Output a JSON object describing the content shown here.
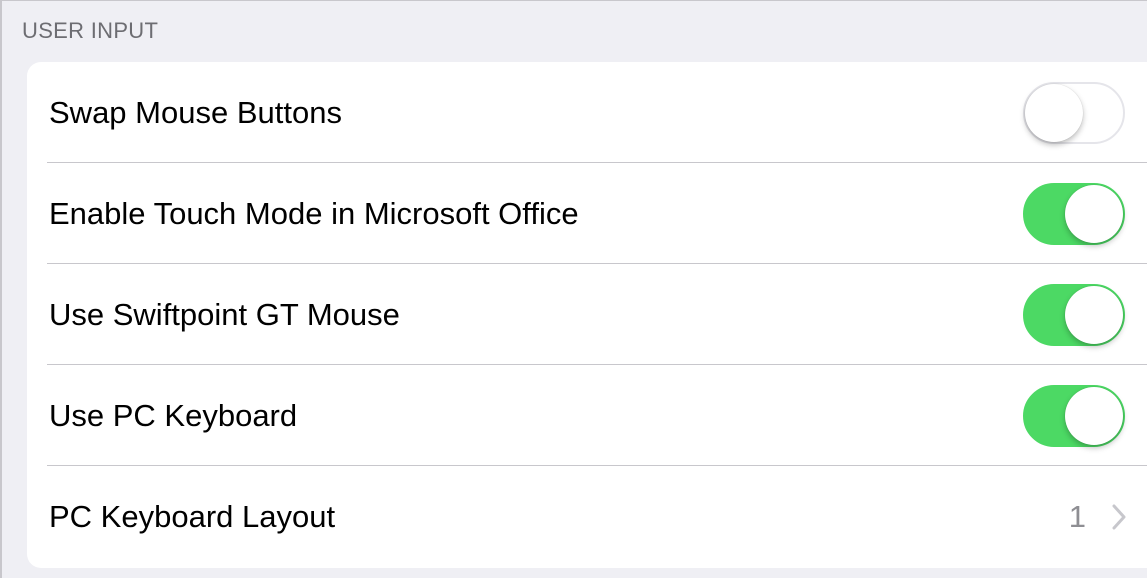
{
  "section": {
    "header": "USER INPUT"
  },
  "rows": [
    {
      "label": "Swap Mouse Buttons",
      "toggle": false
    },
    {
      "label": "Enable Touch Mode in Microsoft Office",
      "toggle": true
    },
    {
      "label": "Use Swiftpoint GT Mouse",
      "toggle": true
    },
    {
      "label": "Use PC Keyboard",
      "toggle": true
    },
    {
      "label": "PC Keyboard Layout",
      "value": "1",
      "accessory": "chevron-right-icon"
    }
  ],
  "colors": {
    "toggle_on": "#4cd964",
    "toggle_off_border": "#e5e5ea",
    "background": "#efeff4",
    "separator": "#c8c7cc",
    "secondary_text": "#8e8e93"
  }
}
